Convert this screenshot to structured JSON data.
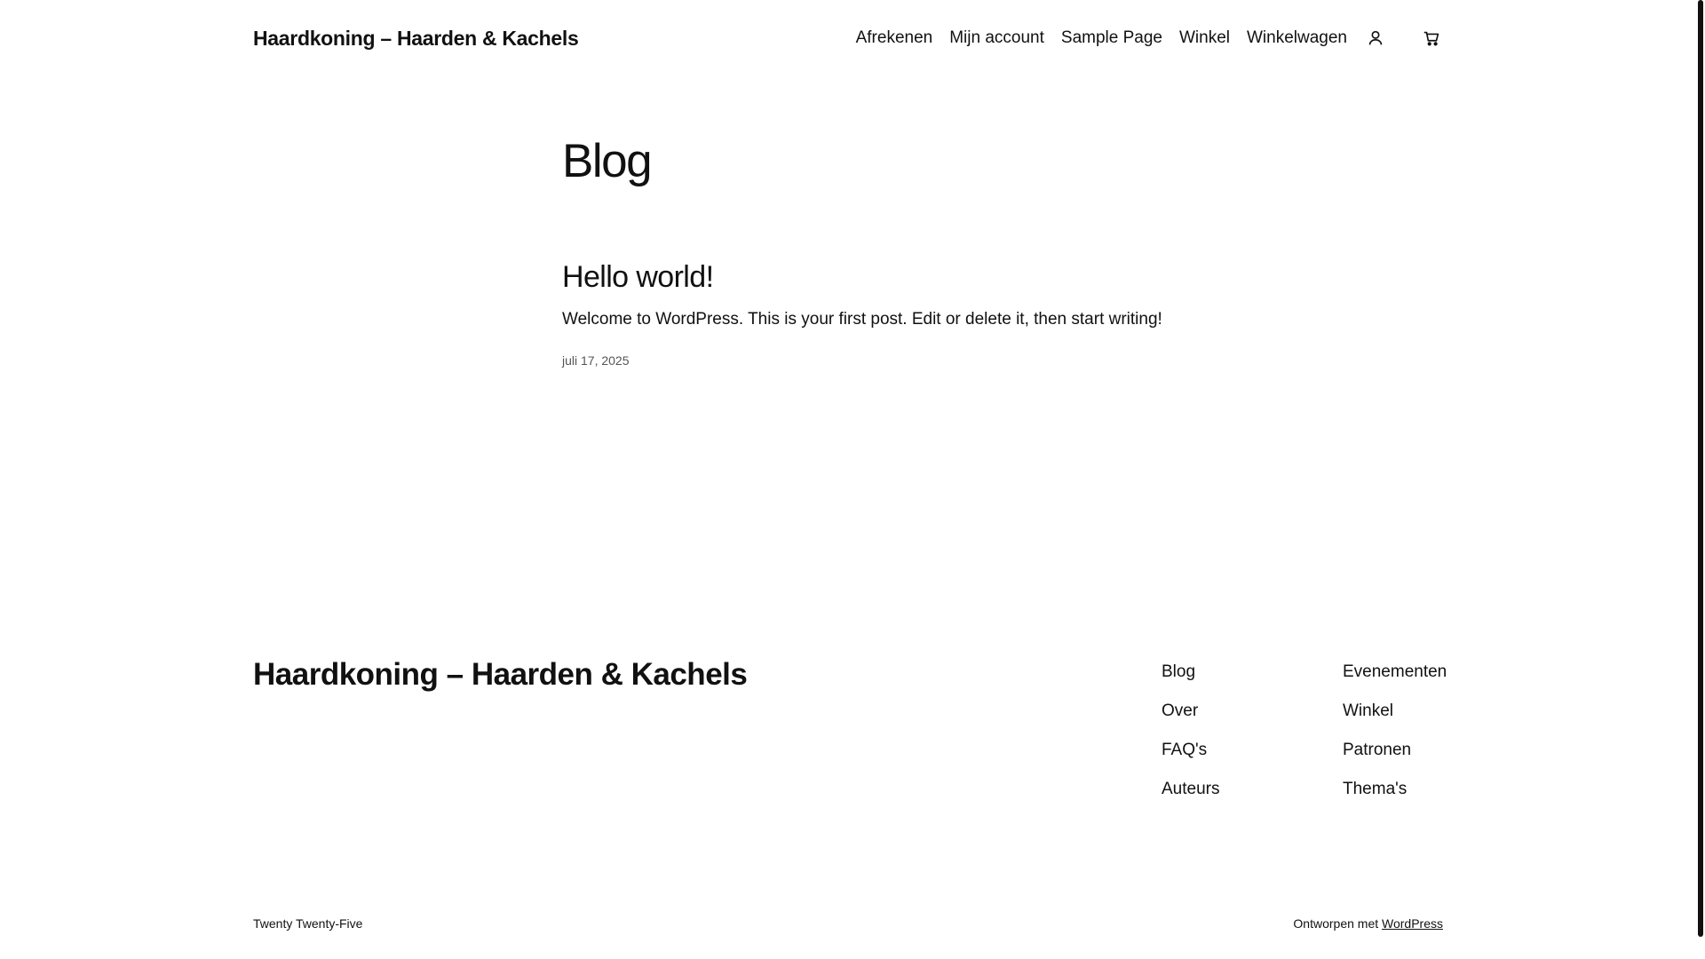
{
  "header": {
    "site_title": "Haardkoning – Haarden & Kachels",
    "nav": [
      "Afrekenen",
      "Mijn account",
      "Sample Page",
      "Winkel",
      "Winkelwagen"
    ],
    "icons": [
      "user-icon",
      "cart-icon"
    ]
  },
  "main": {
    "page_title": "Blog",
    "post": {
      "title": "Hello world!",
      "excerpt": "Welcome to WordPress. This is your first post. Edit or delete it, then start writing!",
      "date": "juli 17, 2025"
    }
  },
  "footer": {
    "site_title": "Haardkoning – Haarden & Kachels",
    "col1": [
      "Blog",
      "Over",
      "FAQ's",
      "Auteurs"
    ],
    "col2": [
      "Evenementen",
      "Winkel",
      "Patronen",
      "Thema's"
    ],
    "theme": "Twenty Twenty-Five",
    "credit_prefix": "Ontworpen met",
    "credit_link": "WordPress"
  }
}
